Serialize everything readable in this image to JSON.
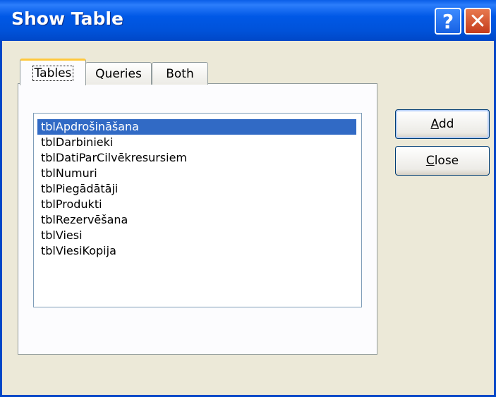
{
  "window": {
    "title": "Show Table",
    "help_glyph": "?",
    "close_glyph": "✕"
  },
  "tabs": [
    {
      "label": "Tables",
      "active": true
    },
    {
      "label": "Queries",
      "active": false
    },
    {
      "label": "Both",
      "active": false
    }
  ],
  "list": {
    "selected_index": 0,
    "items": [
      "tblApdrošināšana",
      "tblDarbinieki",
      "tblDatiParCilvēkresursiem",
      "tblNumuri",
      "tblPiegādātāji",
      "tblProdukti",
      "tblRezervēšana",
      "tblViesi",
      "tblViesiKopija"
    ]
  },
  "buttons": {
    "add_mnemonic": "A",
    "add_rest": "dd",
    "close_mnemonic": "C",
    "close_rest": "lose"
  }
}
